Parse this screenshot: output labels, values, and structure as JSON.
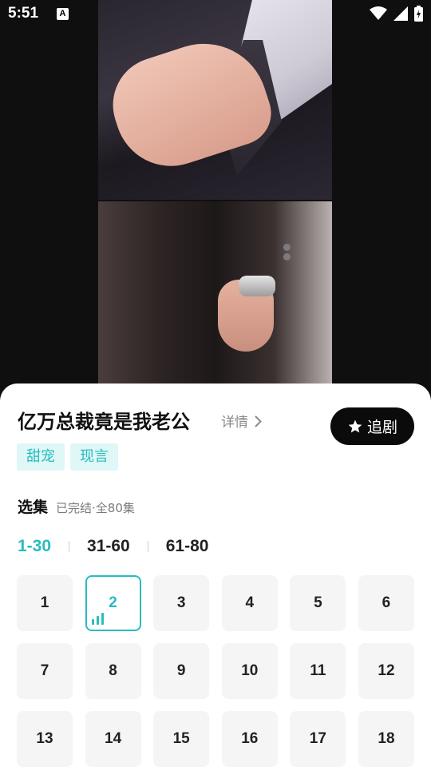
{
  "status_bar": {
    "time": "5:51",
    "notification_icon_letter": "A",
    "icons": [
      "wifi-icon",
      "signal-icon",
      "battery-charging-icon"
    ]
  },
  "video": {
    "description_colors": {
      "suit": "#1d1818",
      "shirt": "#e8e6ee"
    }
  },
  "drama": {
    "title": "亿万总裁竟是我老公",
    "detail_label": "详情",
    "follow_label": "追剧",
    "tags": [
      "甜宠",
      "现言"
    ]
  },
  "episodes": {
    "section_title": "选集",
    "status": "已完结·全80集",
    "ranges": [
      "1-30",
      "31-60",
      "61-80"
    ],
    "active_range": 0,
    "current_episode": 2,
    "items": [
      "1",
      "2",
      "3",
      "4",
      "5",
      "6",
      "7",
      "8",
      "9",
      "10",
      "11",
      "12",
      "13",
      "14",
      "15",
      "16",
      "17",
      "18"
    ]
  },
  "colors": {
    "accent": "#28bcc0",
    "tag_bg": "#dff7f6",
    "button_bg": "#0b0b0b"
  }
}
